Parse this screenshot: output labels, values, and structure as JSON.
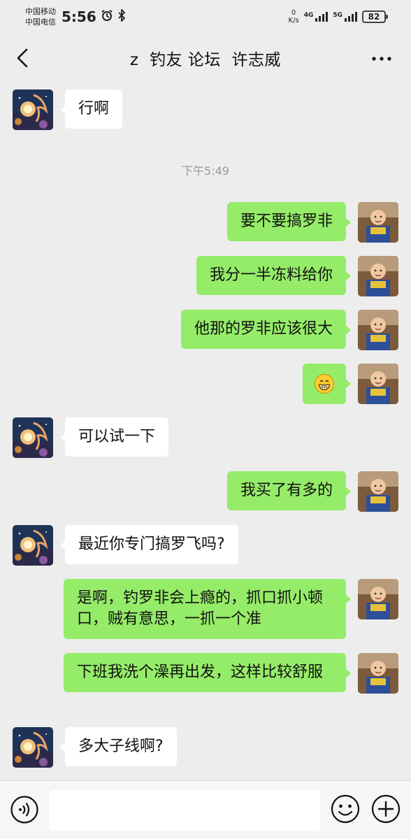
{
  "status_bar": {
    "carrier1": "中国移动",
    "carrier2": "中国电信",
    "time": "5:56",
    "net_speed_value": "0",
    "net_speed_unit": "K/s",
    "signal1_tech": "4G",
    "signal2_tech": "5G",
    "battery": "82"
  },
  "header": {
    "title": "z  钓友 论坛  许志威"
  },
  "messages": [
    {
      "side": "left",
      "text": "行啊"
    },
    {
      "type": "timestamp",
      "text": "下午5:49"
    },
    {
      "side": "right",
      "text": "要不要搞罗非"
    },
    {
      "side": "right",
      "text": "我分一半冻料给你"
    },
    {
      "side": "right",
      "text": "他那的罗非应该很大"
    },
    {
      "side": "right",
      "emoji": "grinning-face-icon"
    },
    {
      "side": "left",
      "text": "可以试一下"
    },
    {
      "side": "right",
      "text": "我买了有多的"
    },
    {
      "side": "left",
      "text": "最近你专门搞罗飞吗?"
    },
    {
      "side": "right",
      "text": "是啊，钓罗非会上瘾的，抓口抓小顿口，贼有意思，一抓一个准"
    },
    {
      "side": "right",
      "text": "下班我洗个澡再出发，这样比较舒服"
    },
    {
      "side": "left",
      "text": "多大子线啊?"
    }
  ],
  "colors": {
    "background": "#ededed",
    "outgoing_bubble": "#95ec69",
    "incoming_bubble": "#ffffff",
    "timestamp": "#9a9a9a"
  },
  "input_bar": {
    "placeholder": ""
  }
}
